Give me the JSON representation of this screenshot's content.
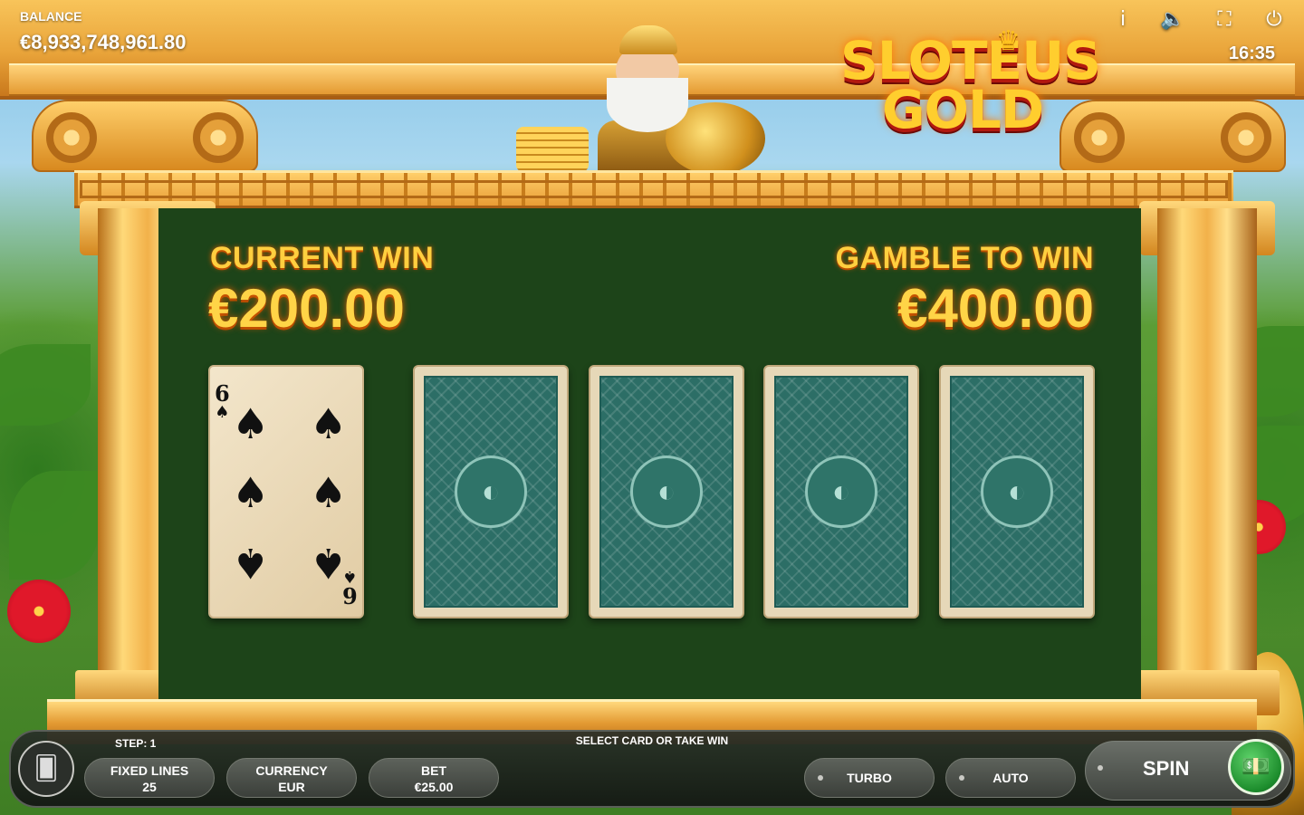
{
  "hud": {
    "balance_label": "BALANCE",
    "balance_value": "€8,933,748,961.80",
    "clock": "16:35",
    "icons": [
      "info-icon",
      "sound-icon",
      "fullscreen-icon",
      "power-icon"
    ]
  },
  "logo": {
    "line1": "SLOTEUS",
    "line2": "GOLD"
  },
  "gamble": {
    "current_win_label": "CURRENT WIN",
    "current_win_value": "€200.00",
    "gamble_label": "GAMBLE TO WIN",
    "gamble_value": "€400.00",
    "dealer_card": {
      "rank": "6",
      "suit": "♠"
    },
    "hidden_cards": 4
  },
  "bottom_bar": {
    "step_label": "STEP: 1",
    "status_text": "SELECT CARD OR TAKE WIN",
    "fixed_lines_label": "FIXED LINES",
    "fixed_lines_value": "25",
    "currency_label": "CURRENCY",
    "currency_value": "EUR",
    "bet_label": "BET",
    "bet_value": "€25.00",
    "turbo_label": "TURBO",
    "auto_label": "AUTO",
    "spin_label": "SPIN"
  },
  "colors": {
    "panel": "#1d4419",
    "win_text": "#ffcf3f",
    "gold": "#f1ad45",
    "collect_button": "#1c8c2c"
  }
}
